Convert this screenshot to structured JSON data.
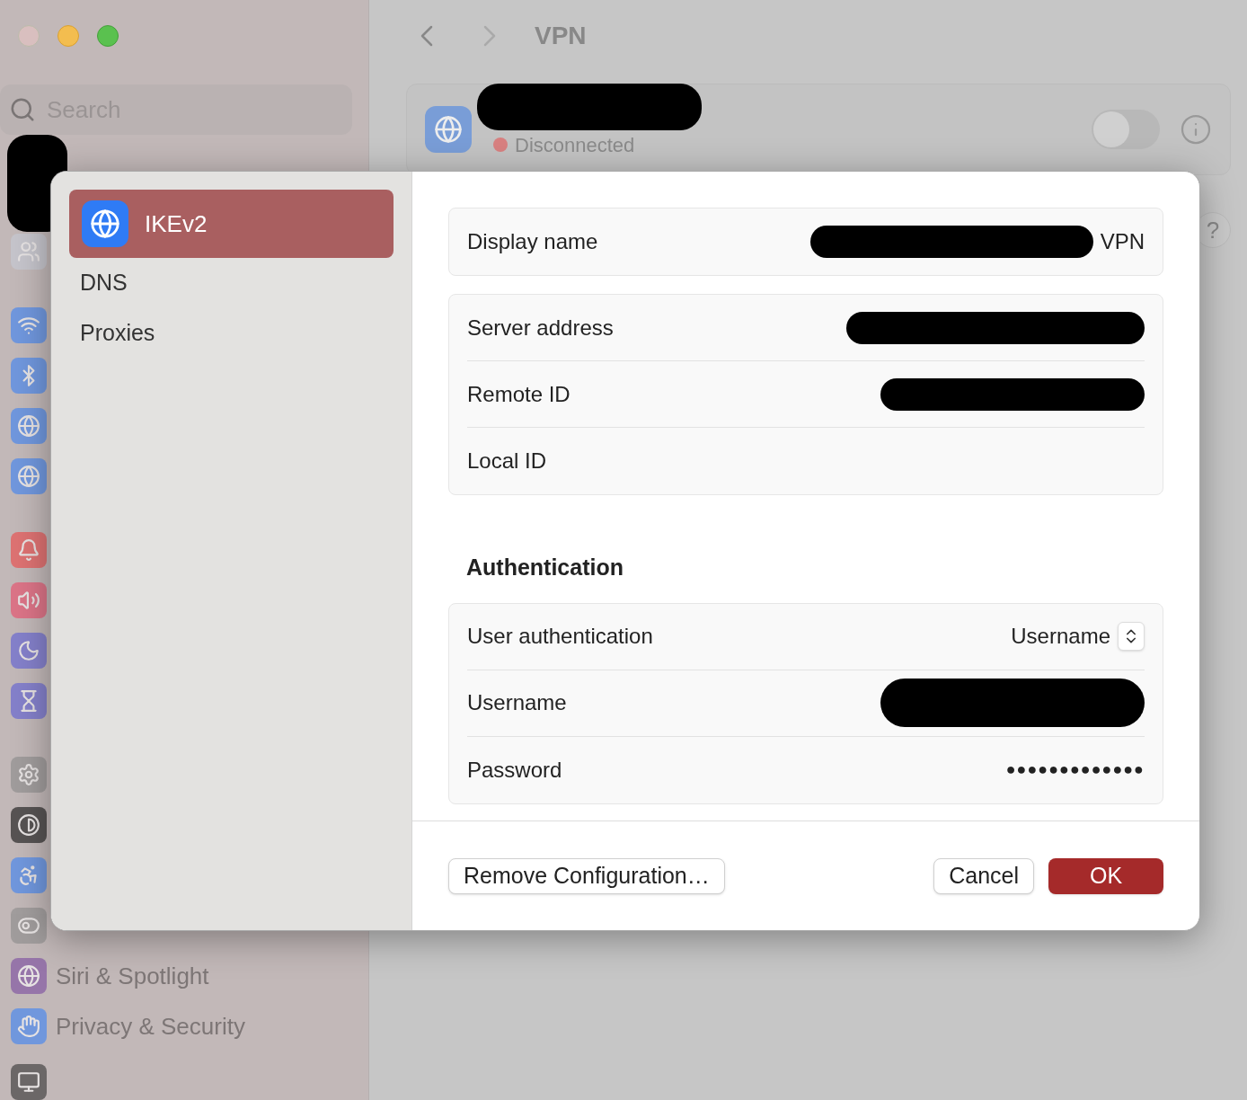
{
  "sidebar": {
    "search": {
      "placeholder": "Search"
    },
    "items": [
      {
        "label": "Siri & Spotlight"
      },
      {
        "label": "Privacy & Security"
      }
    ]
  },
  "toolbar": {
    "title": "VPN",
    "help": "?"
  },
  "vpn_card": {
    "status": "Disconnected",
    "on": false
  },
  "sheet": {
    "tabs": [
      {
        "label": "IKEv2",
        "selected": true
      },
      {
        "label": "DNS",
        "selected": false
      },
      {
        "label": "Proxies",
        "selected": false
      }
    ],
    "groups": [
      {
        "rows": [
          {
            "label": "Display name",
            "value": "VPN",
            "redacted": true
          }
        ]
      },
      {
        "rows": [
          {
            "label": "Server address",
            "redacted": true
          },
          {
            "label": "Remote ID",
            "redacted": true
          },
          {
            "label": "Local ID",
            "redacted": false
          }
        ]
      }
    ],
    "section_heading": "Authentication",
    "auth_rows": [
      {
        "kind": "popup",
        "label": "User authentication",
        "value": "Username"
      },
      {
        "kind": "field",
        "label": "Username",
        "redacted": true
      },
      {
        "kind": "secure",
        "label": "Password",
        "value": "●●●●●●●●●●●●●"
      }
    ],
    "buttons": [
      {
        "label": "Remove Configuration…",
        "default": false
      },
      {
        "label": "Cancel",
        "default": false
      },
      {
        "label": "OK",
        "default": true
      }
    ]
  }
}
